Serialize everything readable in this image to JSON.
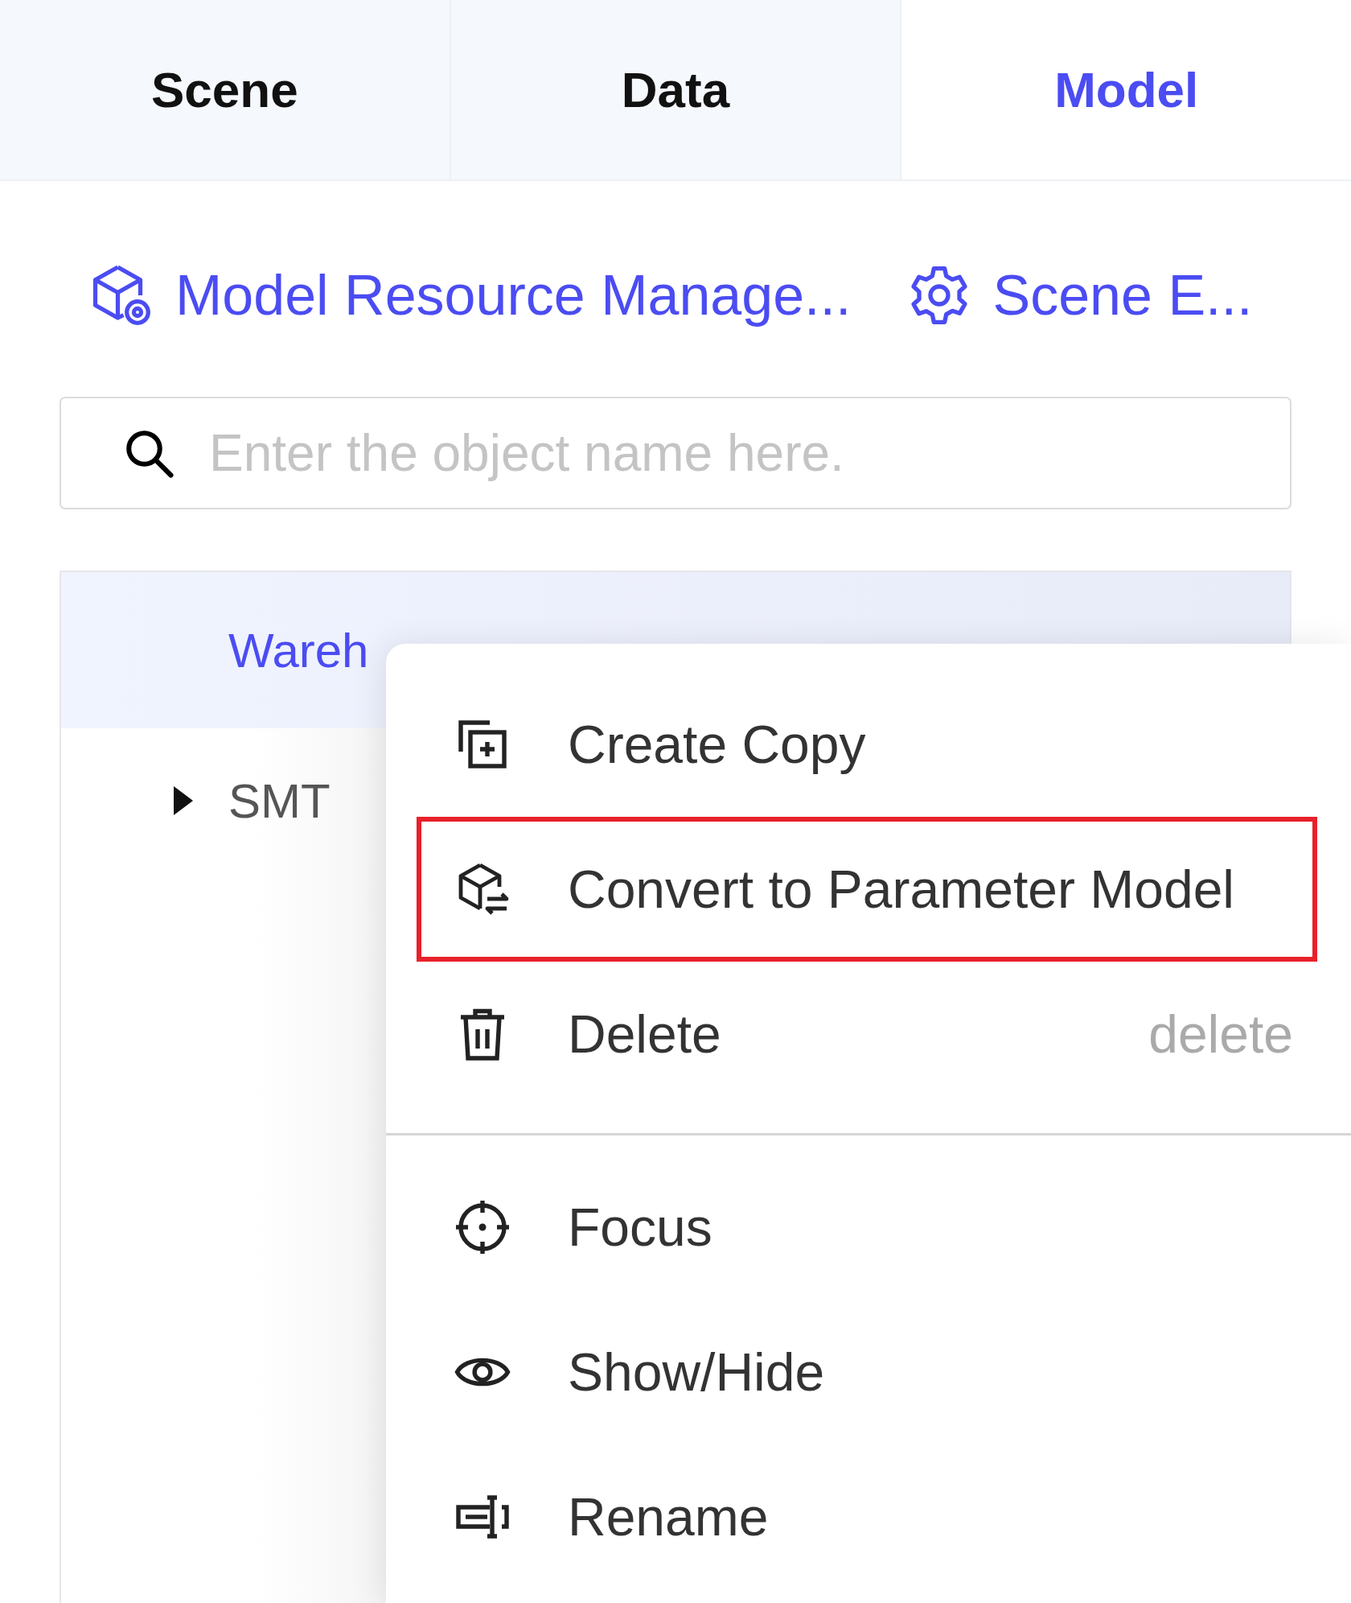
{
  "tabs": [
    {
      "label": "Scene",
      "selected": false
    },
    {
      "label": "Data",
      "selected": false
    },
    {
      "label": "Model",
      "selected": true
    }
  ],
  "toolbar_links": [
    {
      "label": "Model Resource Manage..."
    },
    {
      "label": "Scene E..."
    }
  ],
  "search": {
    "placeholder": "Enter the object name here."
  },
  "tree": {
    "items": [
      {
        "label": "Wareh",
        "selected": true
      },
      {
        "label": "SMT",
        "selected": false,
        "expanded": false
      }
    ]
  },
  "context_menu": {
    "groups": [
      [
        {
          "label": "Create Copy",
          "highlighted": false
        },
        {
          "label": "Convert to Parameter Model",
          "highlighted": true
        },
        {
          "label": "Delete",
          "shortcut": "delete",
          "highlighted": false
        }
      ],
      [
        {
          "label": "Focus",
          "highlighted": false
        },
        {
          "label": "Show/Hide",
          "highlighted": false
        },
        {
          "label": "Rename",
          "highlighted": false
        }
      ]
    ]
  }
}
